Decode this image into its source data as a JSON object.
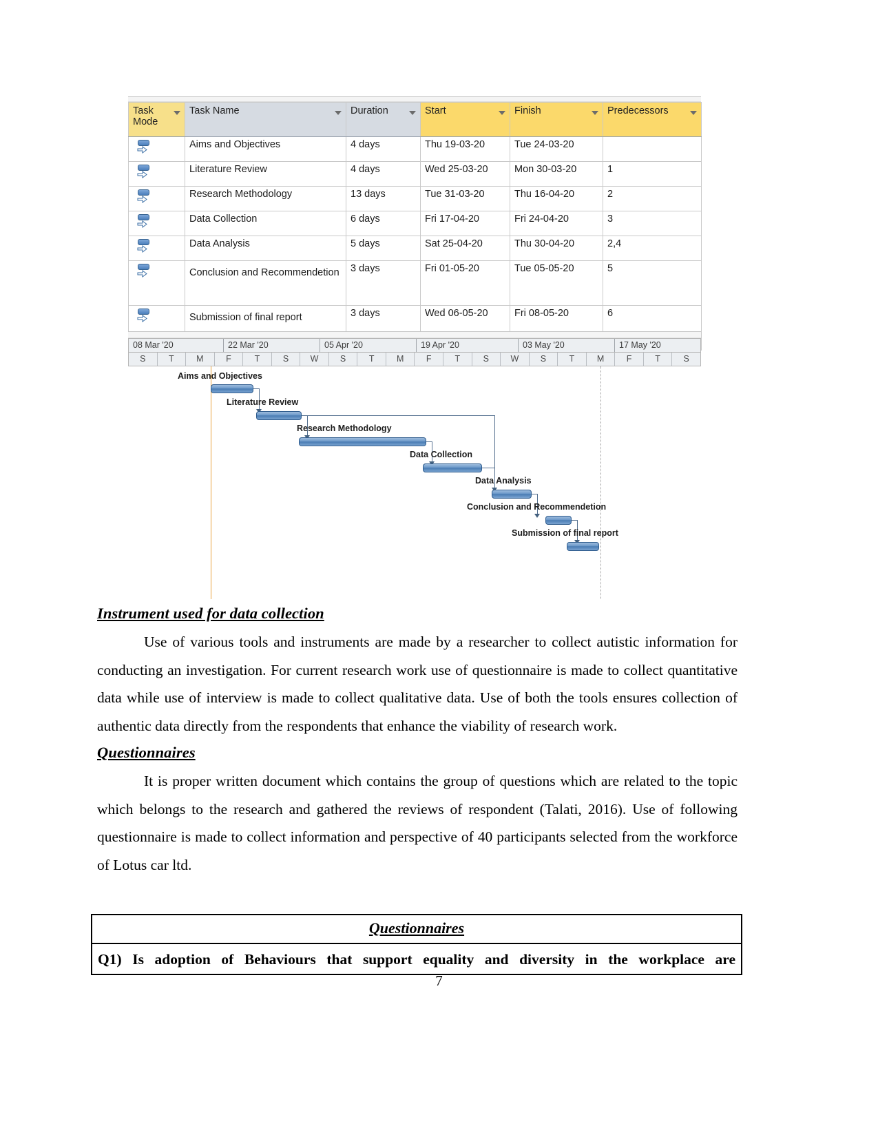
{
  "project_table": {
    "columns": [
      "Task Mode",
      "Task Name",
      "Duration",
      "Start",
      "Finish",
      "Predecessors"
    ],
    "header": {
      "task_mode": "Task\nMode",
      "task_mode_line1": "Task",
      "task_mode_line2": "Mode",
      "task_name": "Task Name",
      "duration": "Duration",
      "start": "Start",
      "finish": "Finish",
      "predecessors": "Predecessors"
    },
    "rows": [
      {
        "mode_icon": "auto-schedule-icon",
        "name": "Aims and Objectives",
        "duration": "4 days",
        "start": "Thu 19-03-20",
        "finish": "Tue 24-03-20",
        "predecessors": ""
      },
      {
        "mode_icon": "auto-schedule-icon",
        "name": "Literature Review",
        "duration": "4 days",
        "start": "Wed 25-03-20",
        "finish": "Mon 30-03-20",
        "predecessors": "1"
      },
      {
        "mode_icon": "auto-schedule-icon",
        "name": "Research Methodology",
        "duration": "13 days",
        "start": "Tue 31-03-20",
        "finish": "Thu 16-04-20",
        "predecessors": "2"
      },
      {
        "mode_icon": "auto-schedule-icon",
        "name": "Data Collection",
        "duration": "6 days",
        "start": "Fri 17-04-20",
        "finish": "Fri 24-04-20",
        "predecessors": "3"
      },
      {
        "mode_icon": "auto-schedule-icon",
        "name": "Data Analysis",
        "duration": "5 days",
        "start": "Sat 25-04-20",
        "finish": "Thu 30-04-20",
        "predecessors": "2,4"
      },
      {
        "mode_icon": "auto-schedule-icon",
        "name": "Conclusion and Recommendetion",
        "duration": "3 days",
        "start": "Fri 01-05-20",
        "finish": "Tue 05-05-20",
        "predecessors": "5"
      },
      {
        "mode_icon": "auto-schedule-icon",
        "name": "Submission of final report",
        "duration": "3 days",
        "start": "Wed 06-05-20",
        "finish": "Fri 08-05-20",
        "predecessors": "6"
      }
    ]
  },
  "gantt": {
    "timeline_weeks": [
      "08 Mar '20",
      "22 Mar '20",
      "05 Apr '20",
      "19 Apr '20",
      "03 May '20",
      "17 May '20"
    ],
    "day_ticks": [
      "S",
      "T",
      "M",
      "F",
      "T",
      "S",
      "W",
      "S",
      "T",
      "M",
      "F",
      "T",
      "S",
      "W",
      "S",
      "T",
      "M",
      "F",
      "T",
      "S"
    ],
    "bars": [
      {
        "label": "Aims and Objectives",
        "duration": "4 days"
      },
      {
        "label": "Literature Review",
        "duration": "4 days"
      },
      {
        "label": "Research Methodology",
        "duration": "13 days"
      },
      {
        "label": "Data Collection",
        "duration": "6 days"
      },
      {
        "label": "Data Analysis",
        "duration": "5 days"
      },
      {
        "label": "Conclusion and Recommendetion",
        "duration": "3 days"
      },
      {
        "label": "Submission of final report",
        "duration": "3 days"
      }
    ],
    "bar_color": "#4a7cb3",
    "today_line_color": "#e8a33d"
  },
  "document": {
    "heading_1": "Instrument used for data collection ",
    "para_1": "Use of various tools and instruments are made by a researcher to collect autistic information for conducting an investigation. For current research work use of questionnaire is made to collect quantitative data while use of interview is made to collect qualitative data. Use of both the tools ensures collection of authentic data directly from the respondents that enhance the viability of research work.",
    "heading_2": "Questionnaires",
    "para_2": "It is proper written document which contains the group of questions which are related to the topic which belongs to the research and gathered the reviews of respondent (Talati, 2016). Use of following questionnaire is made to collect information and perspective of 40 participants selected from the workforce of Lotus car ltd.",
    "questionnaire_box": {
      "title": "Questionnaires",
      "question_1": "Q1) Is adoption of Behaviours that support equality and diversity in the workplace are"
    },
    "page_number": "7"
  }
}
